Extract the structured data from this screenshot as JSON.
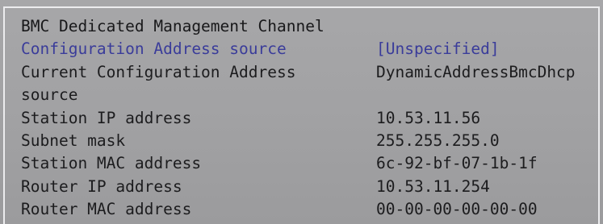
{
  "section_title": "BMC Dedicated Management Channel",
  "colors": {
    "background": "#a2a2a4",
    "text": "#1c1c1e",
    "highlight": "#3a3c9a",
    "border": "#ececee"
  },
  "fields": [
    {
      "label": "Configuration Address source",
      "value": "[Unspecified]"
    },
    {
      "label": "Current Configuration Address",
      "value": "DynamicAddressBmcDhcp"
    },
    {
      "label": "source",
      "value": ""
    },
    {
      "label": "Station IP address",
      "value": "10.53.11.56"
    },
    {
      "label": "Subnet mask",
      "value": "255.255.255.0"
    },
    {
      "label": "Station MAC address",
      "value": "6c-92-bf-07-1b-1f"
    },
    {
      "label": "Router IP address",
      "value": "10.53.11.254"
    },
    {
      "label": "Router MAC address",
      "value": "00-00-00-00-00-00"
    }
  ]
}
